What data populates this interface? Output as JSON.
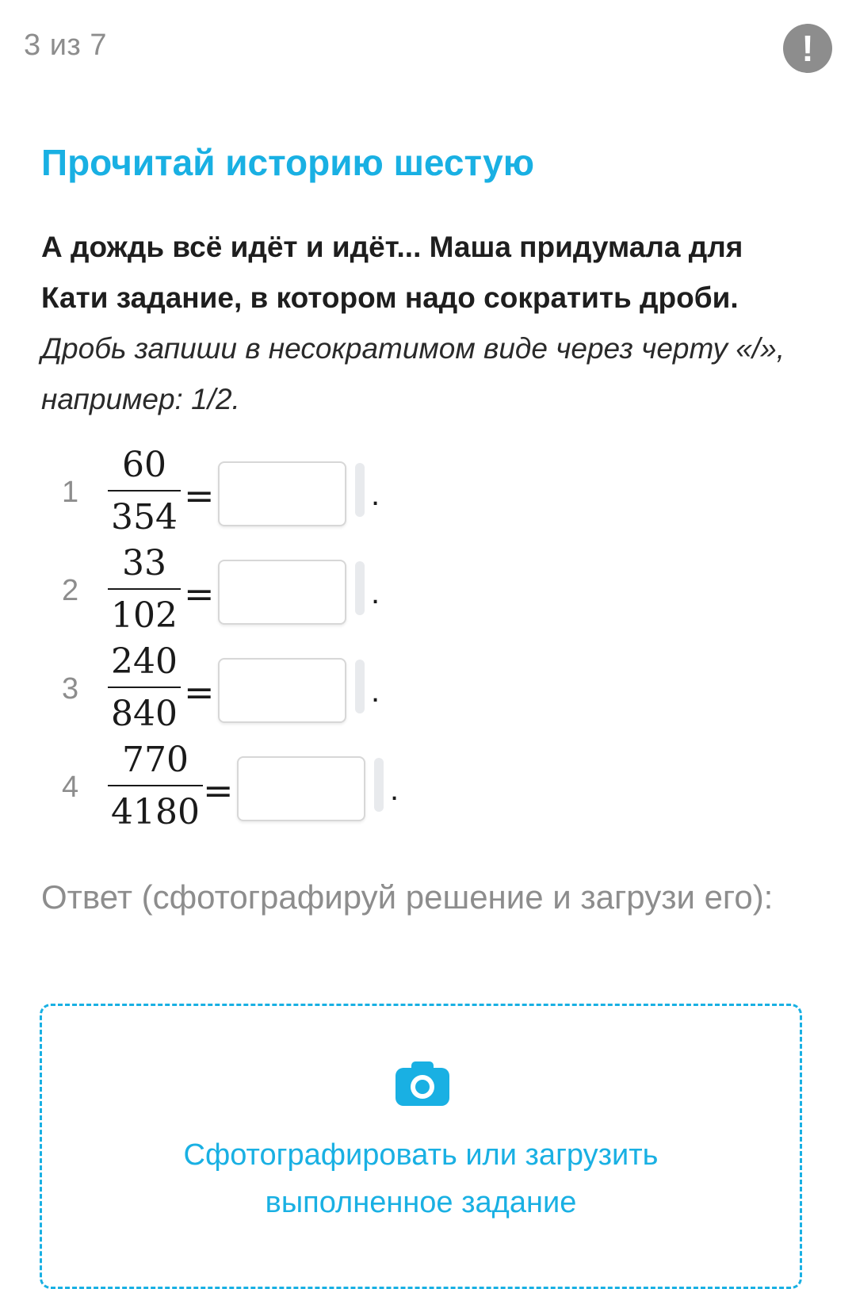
{
  "header": {
    "progress": "3 из 7",
    "alert_symbol": "!"
  },
  "task": {
    "title": "Прочитай историю шестую",
    "story": "А дождь всё идёт и идёт... Маша придумала для Кати задание, в котором надо сократить дроби.",
    "instruction": "Дробь запиши в несократимом виде через черту «/», например: 1/2."
  },
  "problems": [
    {
      "number": "1",
      "numerator": "60",
      "denominator": "354",
      "equals": "=",
      "answer": "",
      "period": "."
    },
    {
      "number": "2",
      "numerator": "33",
      "denominator": "102",
      "equals": "=",
      "answer": "",
      "period": "."
    },
    {
      "number": "3",
      "numerator": "240",
      "denominator": "840",
      "equals": "=",
      "answer": "",
      "period": "."
    },
    {
      "number": "4",
      "numerator": "770",
      "denominator": "4180",
      "equals": "=",
      "answer": "",
      "period": "."
    }
  ],
  "answer_section": {
    "label": "Ответ (сфотографируй решение и загрузи его):",
    "upload_label_line1": "Сфотографировать или загрузить",
    "upload_label_line2": "выполненное задание",
    "icon": "camera-icon"
  },
  "colors": {
    "accent": "#19b0e3",
    "muted": "#8d8d8d",
    "text": "#1e1e1e"
  }
}
